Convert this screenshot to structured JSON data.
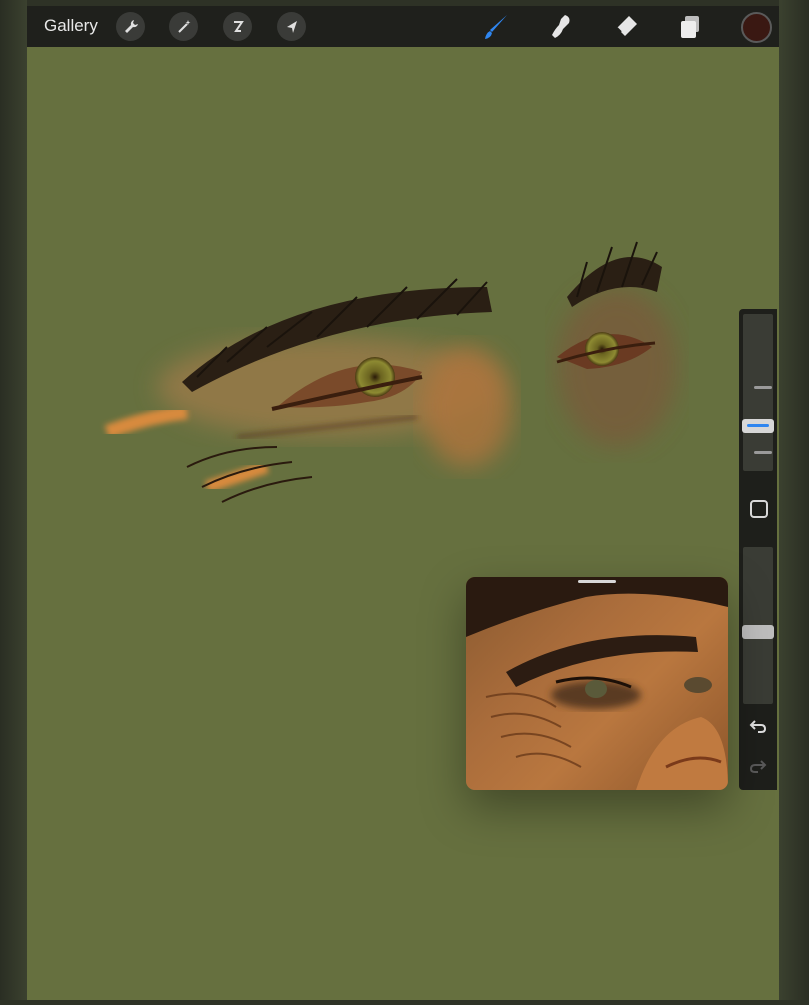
{
  "toolbar": {
    "gallery_label": "Gallery",
    "left_tools": [
      {
        "icon": "wrench-icon",
        "name": "actions"
      },
      {
        "icon": "magic-wand-icon",
        "name": "adjustments"
      },
      {
        "icon": "selection-icon",
        "name": "selection"
      },
      {
        "icon": "arrow-cursor-icon",
        "name": "transform"
      }
    ],
    "right_tools": [
      {
        "icon": "brush-icon",
        "name": "paint",
        "active": true
      },
      {
        "icon": "smudge-icon",
        "name": "smudge",
        "active": false
      },
      {
        "icon": "eraser-icon",
        "name": "erase",
        "active": false
      },
      {
        "icon": "layers-icon",
        "name": "layers",
        "active": false
      }
    ],
    "current_color": "#3a1812"
  },
  "sidebar": {
    "brush_size_icon": "size-slider",
    "opacity_icon": "opacity-slider",
    "modify_icon": "square-icon",
    "undo_icon": "undo-icon",
    "redo_icon": "redo-icon"
  },
  "colors": {
    "canvas": "#66703f",
    "toolbar": "#1f201c",
    "accent": "#2f86f0"
  },
  "reference": {
    "title": ""
  }
}
